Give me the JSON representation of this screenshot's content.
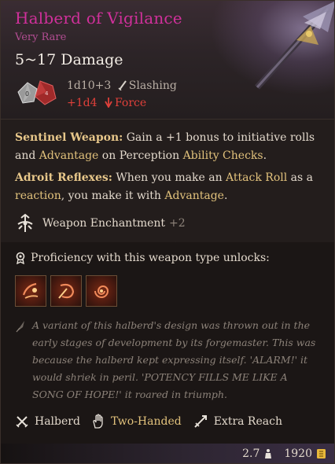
{
  "item": {
    "name": "Halberd of Vigilance",
    "rarity": "Very Rare",
    "damage_title": "5~17 Damage",
    "base_dice": "1d10+3",
    "damage_type": "Slashing",
    "bonus_dice": "+1d4",
    "bonus_type": "Force"
  },
  "passives": {
    "sentinel": {
      "label": "Sentinel Weapon:",
      "t1": " Gain a +1 bonus to initiative rolls and ",
      "k1": "Advantage",
      "t2": " on Perception ",
      "k2": "Ability Checks",
      "t3": "."
    },
    "adroit": {
      "label": "Adroit Reflexes:",
      "t1": " When you make an ",
      "k1": "Attack Roll",
      "t2": " as a ",
      "k2": "reaction",
      "t3": ", you make it with ",
      "k3": "Advantage",
      "t4": "."
    },
    "enchantment": {
      "label": "Weapon Enchantment",
      "bonus": "+2"
    }
  },
  "proficiency": {
    "label": "Proficiency with this weapon type unlocks:",
    "actions": [
      "slash-action-icon",
      "spin-action-icon",
      "swirl-action-icon"
    ]
  },
  "flavor_text": "A variant of this halberd's design was thrown out in the early stages of development by its forgemaster. This was because the halberd kept expressing itself. 'ALARM!' it would shriek in peril. 'POTENCY FILLS ME LIKE A SONG OF HOPE!' it roared in triumph.",
  "properties": {
    "weapon_type": "Halberd",
    "handedness": "Two-Handed",
    "reach": "Extra Reach"
  },
  "footer": {
    "weight": "2.7",
    "value": "1920"
  },
  "colors": {
    "name": "#d0309b",
    "rarity": "#b24d92",
    "keyword": "#e2c27c",
    "force": "#e0403a",
    "gold": "#e8b83a"
  }
}
